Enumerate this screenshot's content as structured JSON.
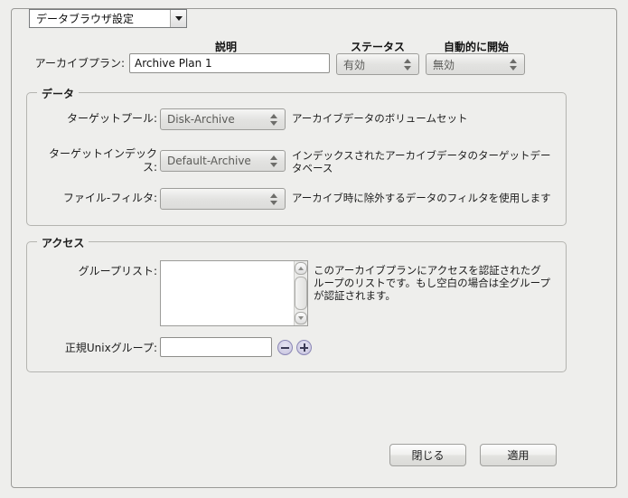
{
  "page_selector": {
    "value": "データブラウザ設定",
    "dropdown_icon": "chevron-down-icon"
  },
  "header": {
    "description_column": "説明",
    "status_column": "ステータス",
    "autostart_column": "自動的に開始"
  },
  "archive_plan": {
    "label": "アーカイブプラン:",
    "value": "Archive Plan 1",
    "status_value": "有効",
    "autostart_value": "無効"
  },
  "data_group": {
    "title": "データ",
    "rows": [
      {
        "label": "ターゲットプール:",
        "value": "Disk-Archive",
        "description": "アーカイブデータのボリュームセット"
      },
      {
        "label": "ターゲットインデック\nス:",
        "value": "Default-Archive",
        "description": "インデックスされたアーカイブデータのターゲットデー\nタベース"
      },
      {
        "label": "ファイル-フィルタ:",
        "value": "",
        "description": "アーカイブ時に除外するデータのフィルタを使用します"
      }
    ]
  },
  "access_group": {
    "title": "アクセス",
    "group_list": {
      "label": "グループリスト:",
      "items": [],
      "description": "このアーカイブプランにアクセスを認証されたグ\nループのリストです。もし空白の場合は全グループ\nが認証されます。"
    },
    "unix_group": {
      "label": "正規Unixグループ:",
      "value": "",
      "remove_icon": "minus-circle-icon",
      "add_icon": "plus-circle-icon"
    }
  },
  "footer": {
    "close_label": "閉じる",
    "apply_label": "適用"
  },
  "colors": {
    "window_background": "#eeeeec",
    "field_background": "#ffffff",
    "border": "#9a9a97",
    "group_border": "#b4b4b0",
    "circle_button_accent": "#8b87b5"
  }
}
